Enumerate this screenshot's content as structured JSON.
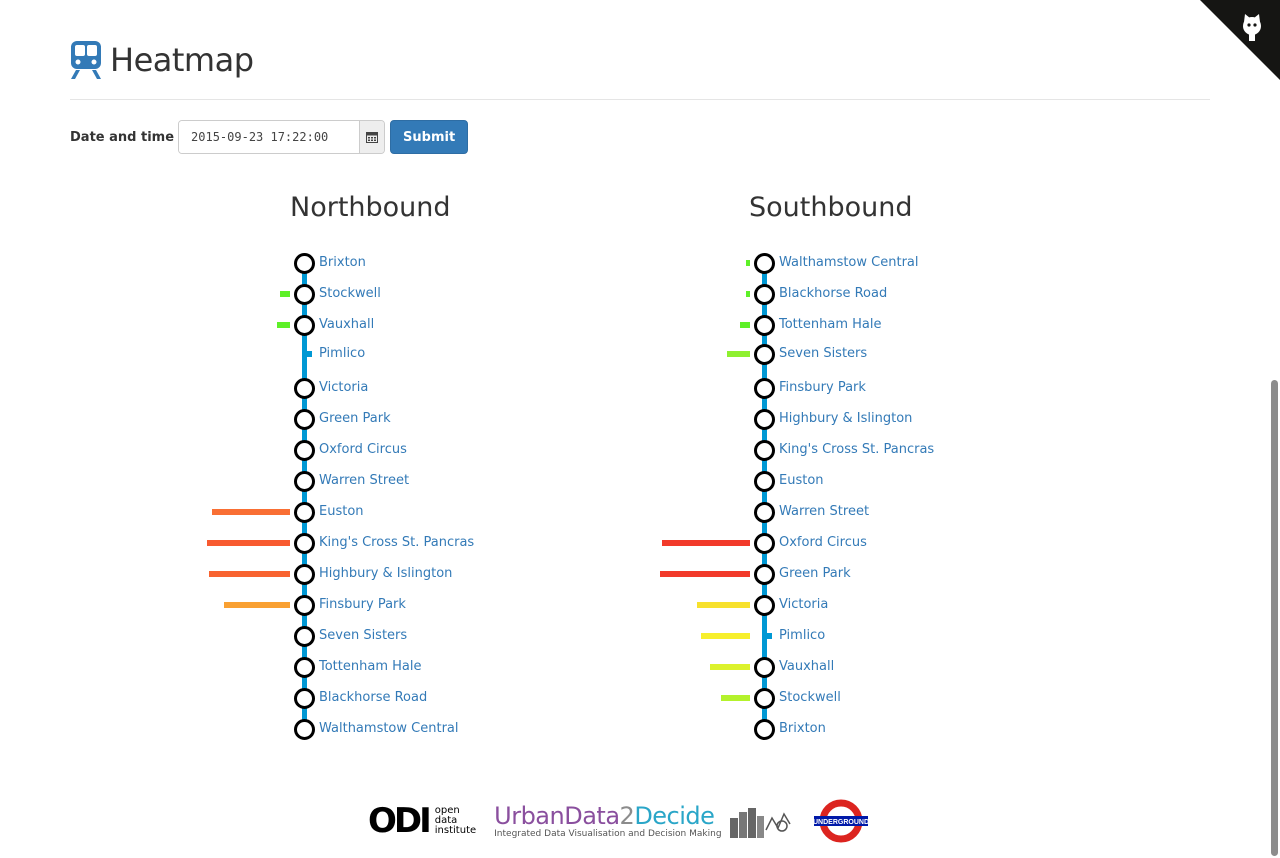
{
  "header": {
    "title": "Heatmap",
    "icon": "train-icon"
  },
  "form": {
    "label": "Date and time",
    "datetime_value": "2015-09-23 17:22:00",
    "submit_label": "Submit"
  },
  "northbound": {
    "title": "Northbound",
    "stations": [
      {
        "name": "Brixton",
        "stop": true,
        "level": 0,
        "color": ""
      },
      {
        "name": "Stockwell",
        "stop": true,
        "level": 0.11,
        "color": "#5ef028"
      },
      {
        "name": "Vauxhall",
        "stop": true,
        "level": 0.14,
        "color": "#5ef028"
      },
      {
        "name": "Pimlico",
        "stop": false,
        "level": 0,
        "color": ""
      },
      {
        "name": "Victoria",
        "stop": true,
        "level": 0,
        "color": ""
      },
      {
        "name": "Green Park",
        "stop": true,
        "level": 0,
        "color": ""
      },
      {
        "name": "Oxford Circus",
        "stop": true,
        "level": 0,
        "color": ""
      },
      {
        "name": "Warren Street",
        "stop": true,
        "level": 0,
        "color": ""
      },
      {
        "name": "Euston",
        "stop": true,
        "level": 0.82,
        "color": "#f96f34"
      },
      {
        "name": "King's Cross St. Pancras",
        "stop": true,
        "level": 0.87,
        "color": "#f85a30"
      },
      {
        "name": "Highbury & Islington",
        "stop": true,
        "level": 0.85,
        "color": "#f86330"
      },
      {
        "name": "Finsbury Park",
        "stop": true,
        "level": 0.69,
        "color": "#f9a032"
      },
      {
        "name": "Seven Sisters",
        "stop": true,
        "level": 0,
        "color": ""
      },
      {
        "name": "Tottenham Hale",
        "stop": true,
        "level": 0,
        "color": ""
      },
      {
        "name": "Blackhorse Road",
        "stop": true,
        "level": 0,
        "color": ""
      },
      {
        "name": "Walthamstow Central",
        "stop": true,
        "level": 0,
        "color": ""
      }
    ]
  },
  "southbound": {
    "title": "Southbound",
    "stations": [
      {
        "name": "Walthamstow Central",
        "stop": true,
        "level": 0.04,
        "color": "#5ef028"
      },
      {
        "name": "Blackhorse Road",
        "stop": true,
        "level": 0.04,
        "color": "#5ef028"
      },
      {
        "name": "Tottenham Hale",
        "stop": true,
        "level": 0.1,
        "color": "#5ef028"
      },
      {
        "name": "Seven Sisters",
        "stop": true,
        "level": 0.24,
        "color": "#8ef030"
      },
      {
        "name": "Finsbury Park",
        "stop": true,
        "level": 0,
        "color": ""
      },
      {
        "name": "Highbury & Islington",
        "stop": true,
        "level": 0,
        "color": ""
      },
      {
        "name": "King's Cross St. Pancras",
        "stop": true,
        "level": 0,
        "color": ""
      },
      {
        "name": "Euston",
        "stop": true,
        "level": 0,
        "color": ""
      },
      {
        "name": "Warren Street",
        "stop": true,
        "level": 0,
        "color": ""
      },
      {
        "name": "Oxford Circus",
        "stop": true,
        "level": 0.93,
        "color": "#f23a2a"
      },
      {
        "name": "Green Park",
        "stop": true,
        "level": 0.95,
        "color": "#f23a2a"
      },
      {
        "name": "Victoria",
        "stop": true,
        "level": 0.56,
        "color": "#f7e12c"
      },
      {
        "name": "Pimlico",
        "stop": false,
        "level": 0.52,
        "color": "#f7ef2c"
      },
      {
        "name": "Vauxhall",
        "stop": true,
        "level": 0.42,
        "color": "#dcf22c"
      },
      {
        "name": "Stockwell",
        "stop": true,
        "level": 0.3,
        "color": "#b4f22c"
      },
      {
        "name": "Brixton",
        "stop": true,
        "level": 0,
        "color": ""
      }
    ]
  },
  "footer": {
    "odi_mark": "ODI",
    "odi_text": [
      "open",
      "data",
      "institute"
    ],
    "ud_part1": "UrbanData",
    "ud_part2": "2",
    "ud_part3": "Decide",
    "ud_sub": "Integrated Data Visualisation and Decision Making",
    "tfl_text": "UNDERGROUND"
  },
  "colors": {
    "line": "#0098d4",
    "link": "#337ab7",
    "primary": "#337ab7"
  }
}
